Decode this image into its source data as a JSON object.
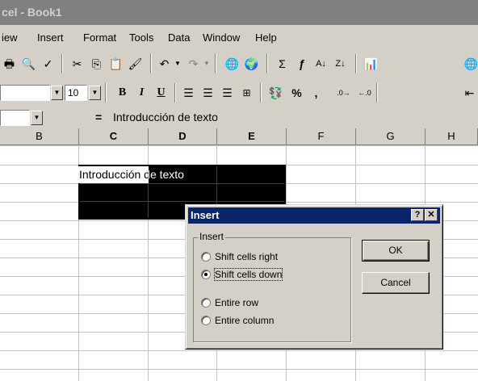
{
  "window": {
    "title": "cel - Book1"
  },
  "menu": [
    "iew",
    "Insert",
    "Format",
    "Tools",
    "Data",
    "Window",
    "Help"
  ],
  "toolbar2": {
    "font_size": "10",
    "bold_label": "B",
    "italic_label": "I",
    "underline_label": "U",
    "percent_label": "%",
    "comma_label": ","
  },
  "formula_bar": {
    "equals": "=",
    "content": "Introducción de texto"
  },
  "columns": [
    "B",
    "C",
    "D",
    "E",
    "F",
    "G",
    "H"
  ],
  "cell": {
    "text": "Introducción de texto"
  },
  "dialog": {
    "title": "Insert",
    "help_label": "?",
    "close_label": "✕",
    "group_label": "Insert",
    "options": [
      "Shift cells right",
      "Shift cells down",
      "Entire row",
      "Entire column"
    ],
    "selected_option": "Shift cells down",
    "ok_label": "OK",
    "cancel_label": "Cancel"
  },
  "colors": {
    "title_active": "#0a246a",
    "face": "#d4d0c8"
  }
}
